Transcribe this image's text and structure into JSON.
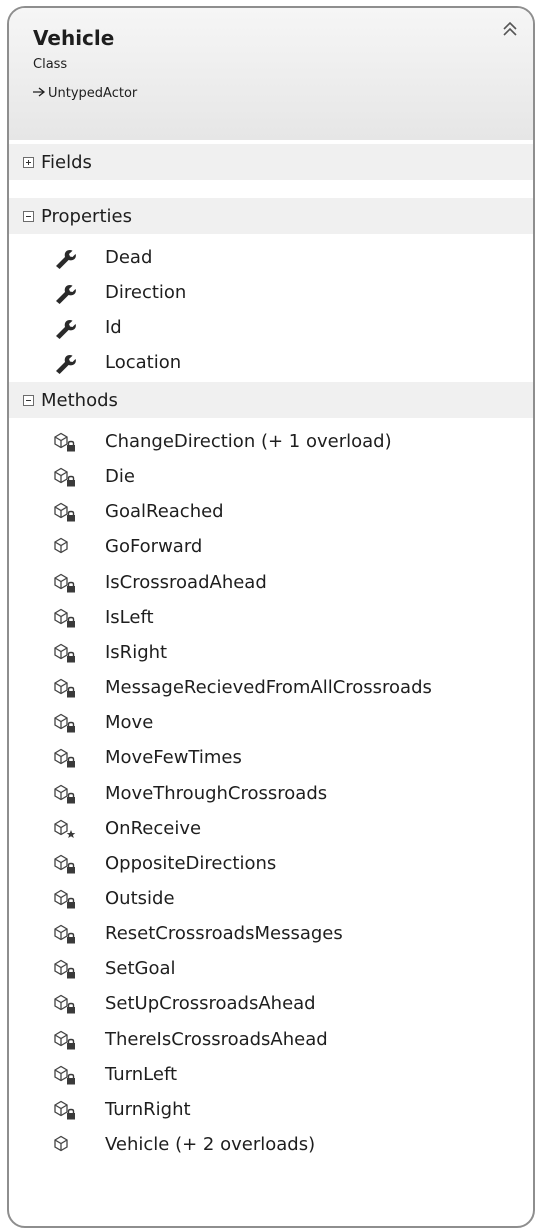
{
  "class": {
    "name": "Vehicle",
    "kind": "Class",
    "base": "UntypedActor"
  },
  "sections": {
    "fields": {
      "label": "Fields",
      "expanded": false
    },
    "properties": {
      "label": "Properties",
      "expanded": true
    },
    "methods": {
      "label": "Methods",
      "expanded": true
    }
  },
  "properties": [
    {
      "name": "Dead",
      "icon": "wrench-icon"
    },
    {
      "name": "Direction",
      "icon": "wrench-icon"
    },
    {
      "name": "Id",
      "icon": "wrench-icon"
    },
    {
      "name": "Location",
      "icon": "wrench-icon"
    }
  ],
  "methods": [
    {
      "name": "ChangeDirection (+ 1 overload)",
      "access": "private"
    },
    {
      "name": "Die",
      "access": "private"
    },
    {
      "name": "GoalReached",
      "access": "private"
    },
    {
      "name": "GoForward",
      "access": "public"
    },
    {
      "name": "IsCrossroadAhead",
      "access": "private"
    },
    {
      "name": "IsLeft",
      "access": "private"
    },
    {
      "name": "IsRight",
      "access": "private"
    },
    {
      "name": "MessageRecievedFromAllCrossroads",
      "access": "private"
    },
    {
      "name": "Move",
      "access": "private"
    },
    {
      "name": "MoveFewTimes",
      "access": "private"
    },
    {
      "name": "MoveThroughCrossroads",
      "access": "private"
    },
    {
      "name": "OnReceive",
      "access": "protected"
    },
    {
      "name": "OppositeDirections",
      "access": "private"
    },
    {
      "name": "Outside",
      "access": "private"
    },
    {
      "name": "ResetCrossroadsMessages",
      "access": "private"
    },
    {
      "name": "SetGoal",
      "access": "private"
    },
    {
      "name": "SetUpCrossroadsAhead",
      "access": "private"
    },
    {
      "name": "ThereIsCrossroadsAhead",
      "access": "private"
    },
    {
      "name": "TurnLeft",
      "access": "private"
    },
    {
      "name": "TurnRight",
      "access": "private"
    },
    {
      "name": "Vehicle (+ 2 overloads)",
      "access": "public"
    }
  ],
  "colors": {
    "border": "#8e8e8e",
    "header_bg": "#e6e6e6",
    "section_bg": "#f0f0f0",
    "text": "#1e1e1e"
  }
}
